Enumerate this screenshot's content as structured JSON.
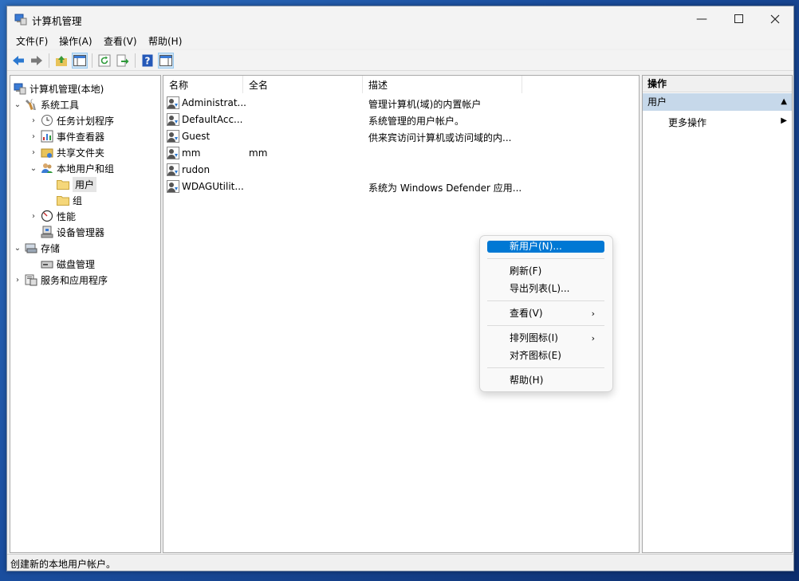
{
  "window": {
    "title": "计算机管理"
  },
  "menubar": {
    "items": [
      "文件(F)",
      "操作(A)",
      "查看(V)",
      "帮助(H)"
    ]
  },
  "tree": {
    "root": "计算机管理(本地)",
    "system_tools": "系统工具",
    "task_scheduler": "任务计划程序",
    "event_viewer": "事件查看器",
    "shared_folders": "共享文件夹",
    "local_users_groups": "本地用户和组",
    "users": "用户",
    "groups": "组",
    "performance": "性能",
    "device_manager": "设备管理器",
    "storage": "存储",
    "disk_management": "磁盘管理",
    "services_apps": "服务和应用程序"
  },
  "list": {
    "columns": [
      "名称",
      "全名",
      "描述"
    ],
    "rows": [
      {
        "name": "Administrat...",
        "full_name": "",
        "desc": "管理计算机(域)的内置帐户"
      },
      {
        "name": "DefaultAcc...",
        "full_name": "",
        "desc": "系统管理的用户帐户。"
      },
      {
        "name": "Guest",
        "full_name": "",
        "desc": "供来宾访问计算机或访问域的内..."
      },
      {
        "name": "mm",
        "full_name": "mm",
        "desc": ""
      },
      {
        "name": "rudon",
        "full_name": "",
        "desc": ""
      },
      {
        "name": "WDAGUtilit...",
        "full_name": "",
        "desc": "系统为 Windows Defender 应用..."
      }
    ]
  },
  "actions": {
    "title": "操作",
    "section": "用户",
    "more": "更多操作"
  },
  "context_menu": {
    "new_user": "新用户(N)...",
    "refresh": "刷新(F)",
    "export": "导出列表(L)...",
    "view": "查看(V)",
    "arrange": "排列图标(I)",
    "align": "对齐图标(E)",
    "help": "帮助(H)"
  },
  "status": {
    "text": "创建新的本地用户帐户。"
  },
  "colors": {
    "accent": "#0078d4",
    "section_bg": "#c6d8ea"
  }
}
